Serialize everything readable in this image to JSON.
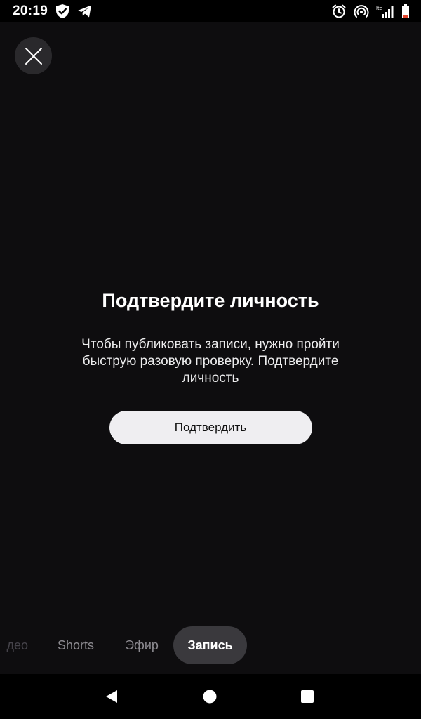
{
  "status_bar": {
    "time": "20:19",
    "icons_left": [
      "shield-check-icon",
      "telegram-icon"
    ],
    "icons_right": [
      "alarm-icon",
      "hotspot-icon",
      "signal-icon",
      "battery-icon"
    ],
    "battery_color": "#e2462d"
  },
  "dialog": {
    "close_icon": "close-icon",
    "title": "Подтвердите личность",
    "description": "Чтобы публиковать записи, нужно пройти быструю разовую проверку. Подтвердите личность",
    "confirm_label": "Подтвердить"
  },
  "mode_tabs": [
    {
      "label": "Видео",
      "visible_text": "део",
      "state": "faded"
    },
    {
      "label": "Shorts",
      "state": "inactive"
    },
    {
      "label": "Эфир",
      "state": "inactive"
    },
    {
      "label": "Запись",
      "state": "active"
    }
  ],
  "nav_bar": {
    "back_icon": "back-triangle-icon",
    "home_icon": "home-circle-icon",
    "recents_icon": "recents-square-icon"
  },
  "colors": {
    "background": "#0e0d0f",
    "button_bg": "#efeef1",
    "active_tab_bg": "#3a393d"
  }
}
